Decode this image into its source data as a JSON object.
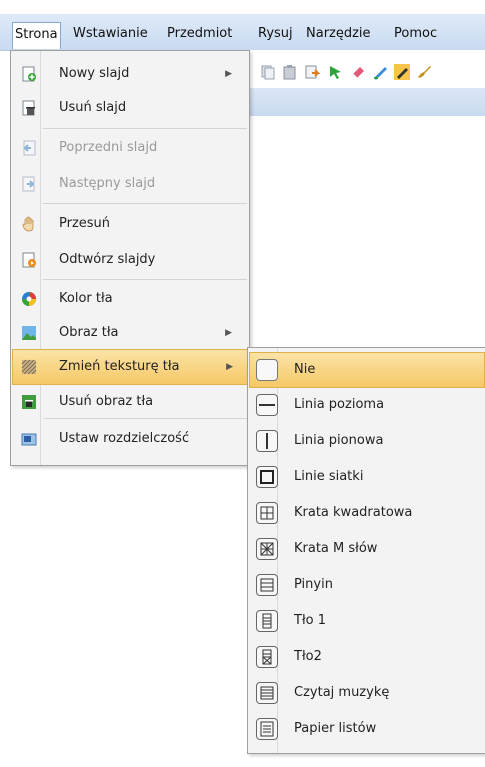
{
  "menubar": {
    "items": [
      "Strona",
      "Wstawianie",
      "Przedmiot",
      "Rysuj",
      "Narzędzie",
      "Pomoc"
    ]
  },
  "strona_menu": {
    "items": [
      {
        "label": "Nowy slajd",
        "icon": "new-slide-icon",
        "submenu": true,
        "enabled": true
      },
      {
        "label": "Usuń slajd",
        "icon": "delete-slide-icon",
        "submenu": false,
        "enabled": true
      },
      {
        "label": "Poprzedni slajd",
        "icon": "previous-slide-icon",
        "submenu": false,
        "enabled": false
      },
      {
        "label": "Następny slajd",
        "icon": "next-slide-icon",
        "submenu": false,
        "enabled": false
      },
      {
        "label": "Przesuń",
        "icon": "hand-icon",
        "submenu": false,
        "enabled": true
      },
      {
        "label": "Odtwórz slajdy",
        "icon": "play-slides-icon",
        "submenu": false,
        "enabled": true
      },
      {
        "label": "Kolor tła",
        "icon": "color-wheel-icon",
        "submenu": false,
        "enabled": true
      },
      {
        "label": "Obraz tła",
        "icon": "background-image-icon",
        "submenu": true,
        "enabled": true
      },
      {
        "label": "Zmień teksturę tła",
        "icon": "texture-icon",
        "submenu": true,
        "enabled": true,
        "highlighted": true
      },
      {
        "label": "Usuń obraz tła",
        "icon": "remove-background-image-icon",
        "submenu": false,
        "enabled": true
      },
      {
        "label": "Ustaw rozdzielczość",
        "icon": "resolution-icon",
        "submenu": false,
        "enabled": true
      }
    ],
    "arrow_glyph": "▶"
  },
  "texture_submenu": {
    "items": [
      {
        "label": "Nie",
        "icon": "no-texture-icon",
        "highlighted": true
      },
      {
        "label": "Linia pozioma",
        "icon": "horizontal-line-icon"
      },
      {
        "label": "Linia pionowa",
        "icon": "vertical-line-icon"
      },
      {
        "label": "Linie siatki",
        "icon": "grid-lines-icon"
      },
      {
        "label": "Krata kwadratowa",
        "icon": "square-lattice-icon"
      },
      {
        "label": "Krata M słów",
        "icon": "m-character-lattice-icon"
      },
      {
        "label": "Pinyin",
        "icon": "pinyin-lines-icon"
      },
      {
        "label": "Tło 1",
        "icon": "background-1-icon"
      },
      {
        "label": "Tło2",
        "icon": "background-2-icon"
      },
      {
        "label": "Czytaj muzykę",
        "icon": "music-staff-icon"
      },
      {
        "label": "Papier listów",
        "icon": "letter-paper-icon"
      }
    ]
  },
  "colors": {
    "highlight": "#f6c867",
    "menubar": "#c8daf1",
    "menu_bg": "#f3f3f3"
  }
}
